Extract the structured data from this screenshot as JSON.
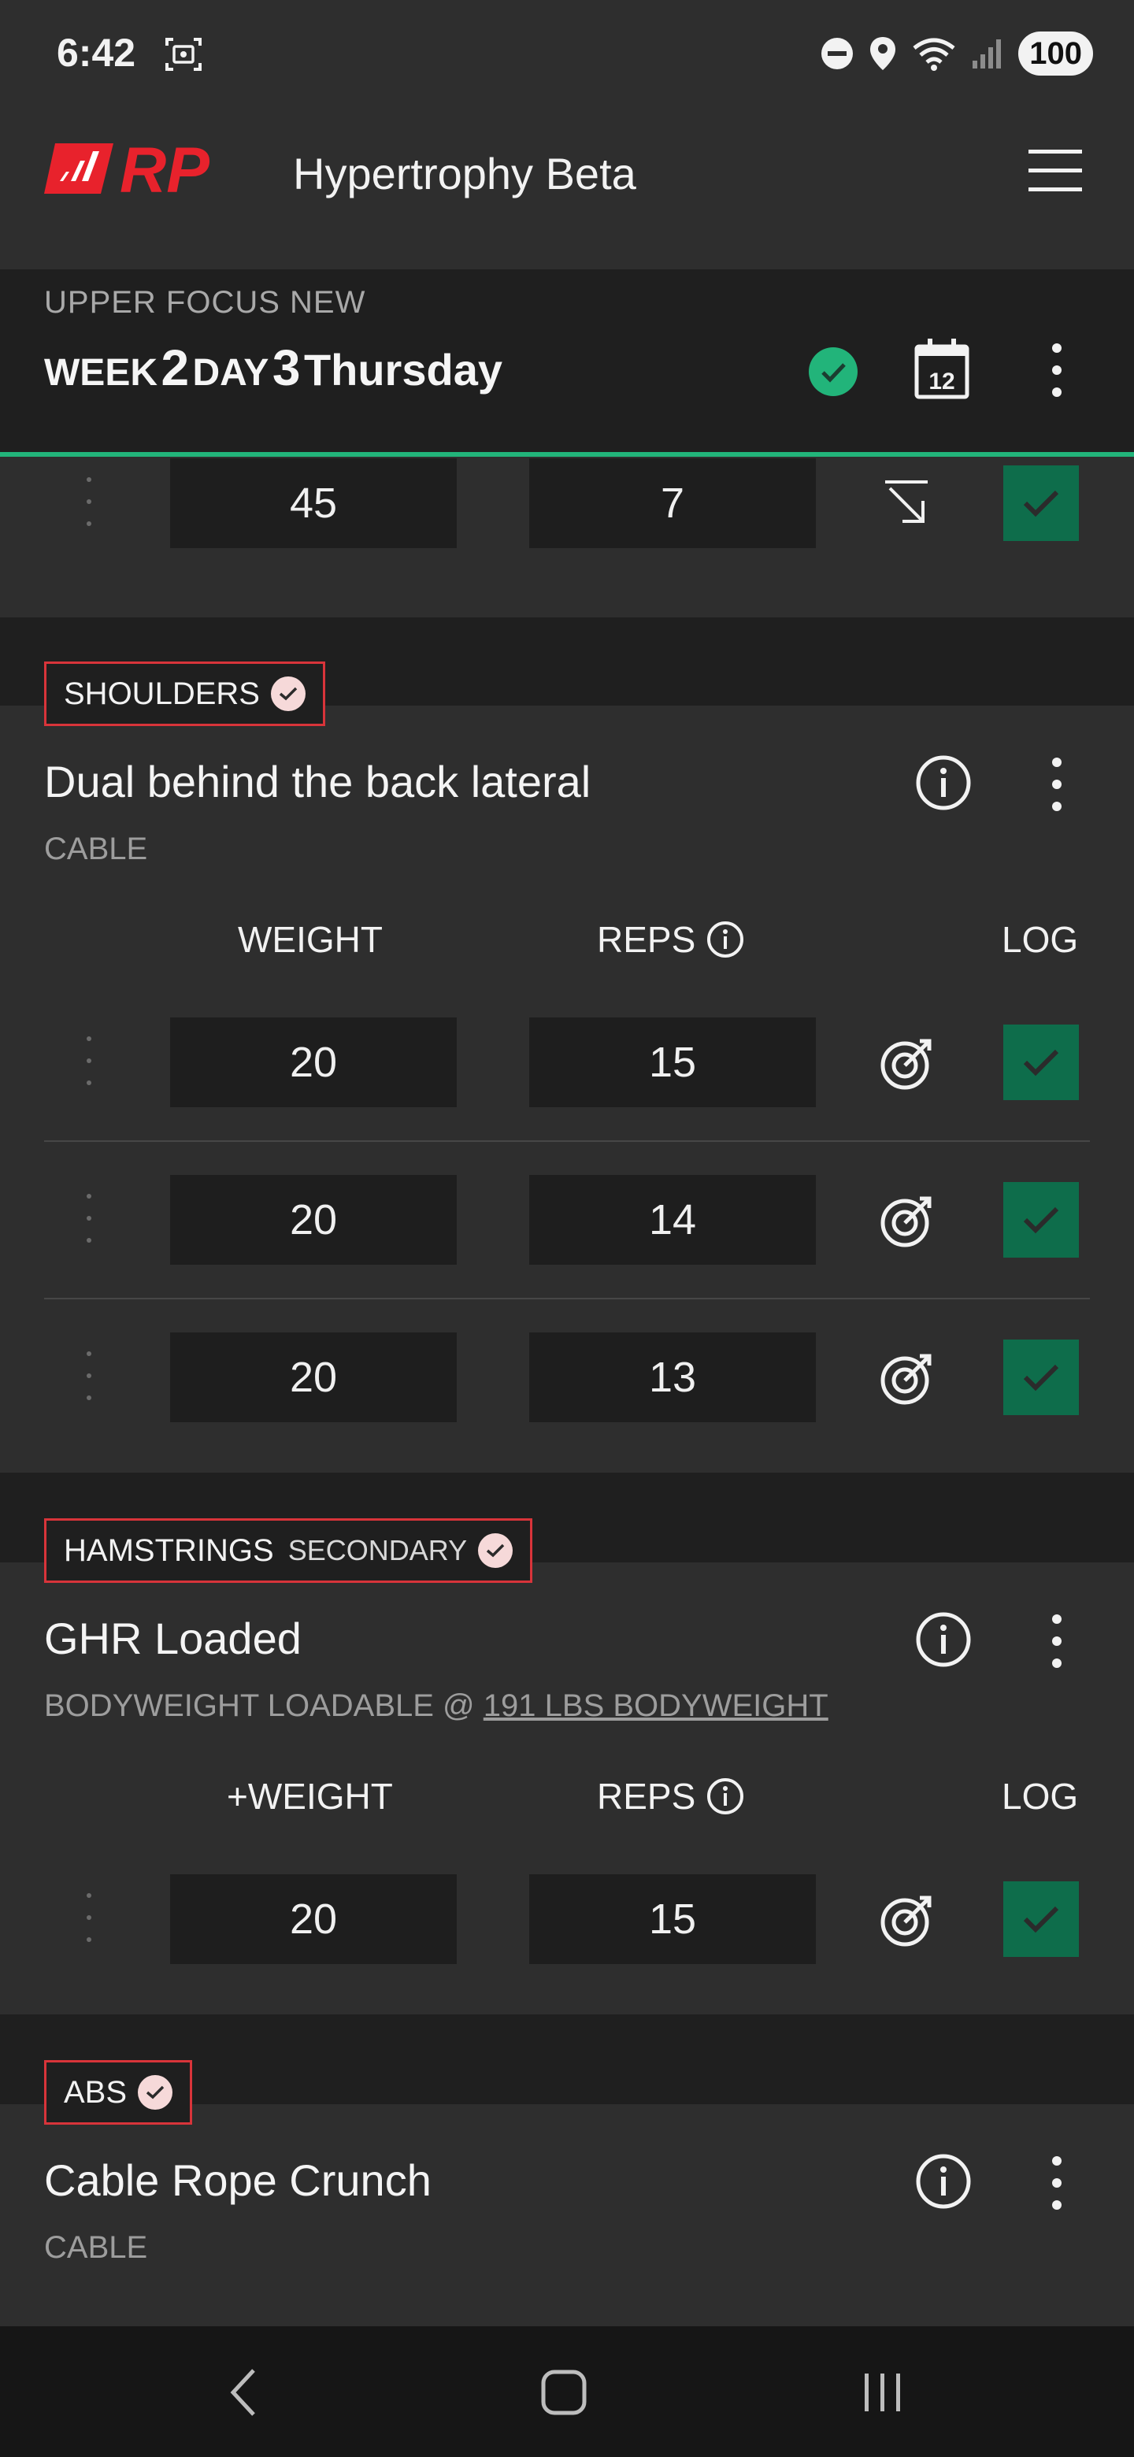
{
  "status_bar": {
    "time": "6:42",
    "battery": "100",
    "icons": [
      "screenshot-icon",
      "do-not-disturb-icon",
      "location-icon",
      "wifi-icon",
      "signal-icon"
    ]
  },
  "header": {
    "logo_text": "RP",
    "app_title": "Hypertrophy Beta",
    "meso_name": "UPPER FOCUS NEW",
    "week_label": "WEEK",
    "week_number": "2",
    "day_label": "DAY",
    "day_number": "3",
    "day_name": "Thursday",
    "calendar_day": "12"
  },
  "colors": {
    "accent_green": "#22b47a",
    "log_green": "#0e6d4b",
    "brand_red": "#e8222c",
    "tag_border": "#d8343a",
    "card_bg": "#2e2e2e",
    "page_bg": "#1f1f1f"
  },
  "partial_exercise": {
    "set": {
      "weight": "45",
      "reps": "7",
      "action_icon": "arrow-down-right-icon"
    }
  },
  "exercises": [
    {
      "muscle": "SHOULDERS",
      "muscle_sub": "",
      "name": "Dual behind the back lateral",
      "type": "CABLE",
      "headers": {
        "weight": "WEIGHT",
        "reps": "REPS",
        "log": "LOG"
      },
      "sets": [
        {
          "weight": "20",
          "reps": "15"
        },
        {
          "weight": "20",
          "reps": "14"
        },
        {
          "weight": "20",
          "reps": "13"
        }
      ]
    },
    {
      "muscle": "HAMSTRINGS",
      "muscle_sub": "SECONDARY",
      "name": "GHR Loaded",
      "type": "BODYWEIGHT LOADABLE @",
      "type_link": "191 LBS BODYWEIGHT",
      "headers": {
        "weight": "+WEIGHT",
        "reps": "REPS",
        "log": "LOG"
      },
      "sets": [
        {
          "weight": "20",
          "reps": "15"
        }
      ]
    },
    {
      "muscle": "ABS",
      "muscle_sub": "",
      "name": "Cable Rope Crunch",
      "type": "CABLE"
    }
  ],
  "nav": {
    "icons": [
      "back-icon",
      "home-icon",
      "recents-icon"
    ]
  }
}
